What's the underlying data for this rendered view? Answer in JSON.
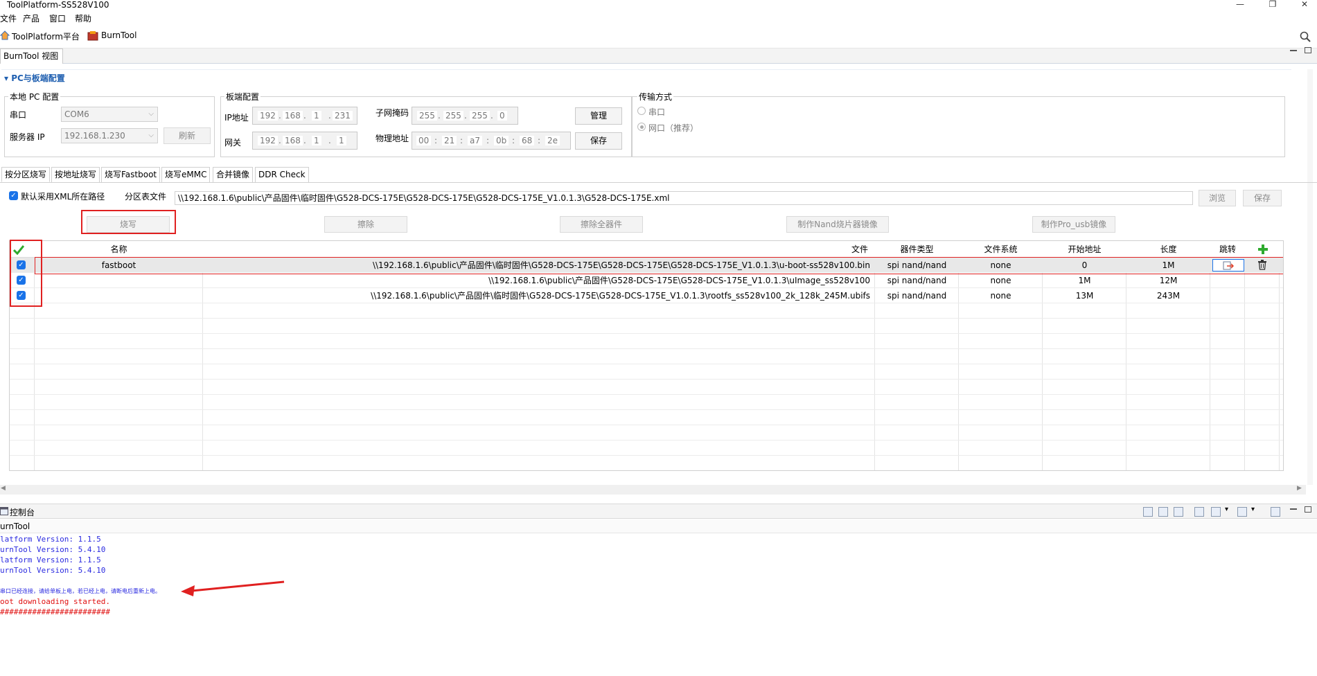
{
  "window": {
    "title": "ToolPlatform-SS528V100",
    "min": "—",
    "restore": "❐",
    "close": "✕"
  },
  "menu": [
    "文件",
    "产品",
    "窗口",
    "帮助"
  ],
  "toolbar": {
    "toolplatform_label": "ToolPlatform平台",
    "burntool_label": "BurnTool"
  },
  "view_tab": {
    "label": "BurnTool 视图"
  },
  "section": {
    "title": "PC与板端配置"
  },
  "local_pc": {
    "group_label": "本地 PC 配置",
    "serial_label": "串口",
    "serial_value": "COM6",
    "server_ip_label": "服务器 IP",
    "server_ip_value": "192.168.1.230",
    "refresh_label": "刷新"
  },
  "board": {
    "group_label": "板端配置",
    "ip_label": "IP地址",
    "ip": [
      "192",
      "168",
      "1",
      "231"
    ],
    "gateway_label": "网关",
    "gateway": [
      "192",
      "168",
      "1",
      "1"
    ],
    "mask_label": "子网掩码",
    "mask": [
      "255",
      "255",
      "255",
      "0"
    ],
    "mac_label": "物理地址",
    "mac": [
      "00",
      "21",
      "a7",
      "0b",
      "68",
      "2e"
    ],
    "manage_label": "管理",
    "save_label": "保存"
  },
  "transfer": {
    "group_label": "传输方式",
    "serial": "串口",
    "network": "网口（推荐）"
  },
  "tabs": [
    "按分区烧写",
    "按地址烧写",
    "烧写Fastboot",
    "烧写eMMC",
    "合并镜像",
    "DDR Check"
  ],
  "burn": {
    "default_xml_label": "默认采用XML所在路径",
    "partition_file_label": "分区表文件",
    "partition_file_value": "\\\\192.168.1.6\\public\\产品固件\\临时固件\\G528-DCS-175E\\G528-DCS-175E\\G528-DCS-175E_V1.0.1.3\\G528-DCS-175E.xml",
    "browse_label": "浏览",
    "save_label": "保存",
    "burn_label": "烧写",
    "erase_label": "擦除",
    "erase_all_label": "擦除全器件",
    "nand_image_label": "制作Nand烧片器镜像",
    "pro_usb_label": "制作Pro_usb镜像"
  },
  "table": {
    "headers": [
      "名称",
      "文件",
      "器件类型",
      "文件系统",
      "开始地址",
      "长度",
      "跳转"
    ],
    "rows": [
      {
        "name": "fastboot",
        "file": "\\\\192.168.1.6\\public\\产品固件\\临时固件\\G528-DCS-175E\\G528-DCS-175E\\G528-DCS-175E_V1.0.1.3\\u-boot-ss528v100.bin",
        "device": "spi nand/nand",
        "fs": "none",
        "start": "0",
        "length": "1M"
      },
      {
        "name": "",
        "file": "\\\\192.168.1.6\\public\\产品固件\\G528-DCS-175E\\G528-DCS-175E_V1.0.1.3\\uImage_ss528v100",
        "device": "spi nand/nand",
        "fs": "none",
        "start": "1M",
        "length": "12M"
      },
      {
        "name": "",
        "file": "\\\\192.168.1.6\\public\\产品固件\\临时固件\\G528-DCS-175E\\G528-DCS-175E_V1.0.1.3\\rootfs_ss528v100_2k_128k_245M.ubifs",
        "device": "spi nand/nand",
        "fs": "none",
        "start": "13M",
        "length": "243M"
      }
    ]
  },
  "console": {
    "tab_label": "控制台",
    "sub_label": "urnTool",
    "lines_blue": [
      "latform Version: 1.1.5",
      "urnTool Version: 5.4.10",
      "latform Version: 1.1.5",
      "urnTool Version: 5.4.10"
    ],
    "notice": "串口已经连接，请给单板上电，若已经上电，请断电后重新上电。",
    "started": "oot downloading started.",
    "progress": "########################"
  },
  "colors": {
    "accent": "#1a73e8",
    "annotation_red": "#e02020",
    "console_blue": "#2a2ae0",
    "console_red": "#e01010"
  }
}
